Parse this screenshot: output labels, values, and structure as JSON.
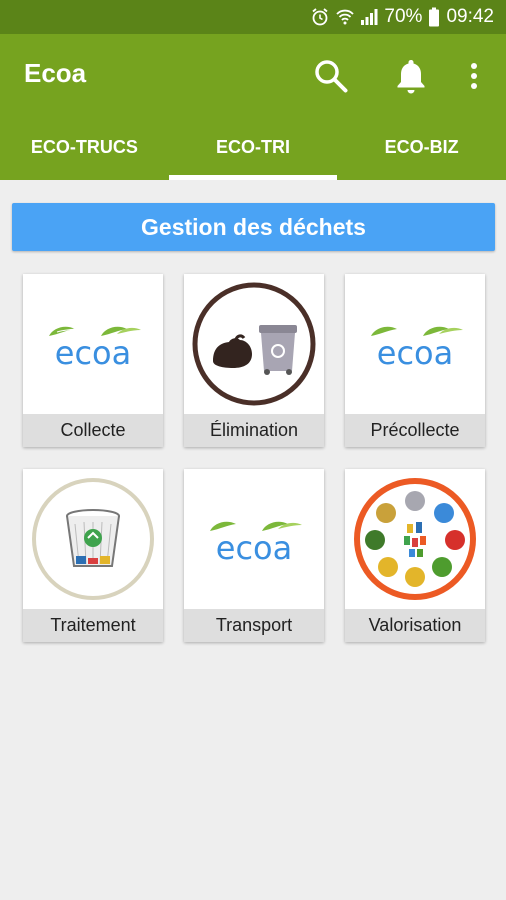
{
  "status_bar": {
    "battery": "70%",
    "time": "09:42"
  },
  "app_bar": {
    "title": "Ecoa"
  },
  "tabs": [
    {
      "label": "ECO-TRUCS",
      "active": false
    },
    {
      "label": "ECO-TRI",
      "active": true
    },
    {
      "label": "ECO-BIZ",
      "active": false
    }
  ],
  "section": {
    "title": "Gestion des déchets"
  },
  "cards": [
    {
      "label": "Collecte",
      "image": "ecoa-logo"
    },
    {
      "label": "Élimination",
      "image": "trash-bag-and-bin"
    },
    {
      "label": "Précollecte",
      "image": "ecoa-logo"
    },
    {
      "label": "Traitement",
      "image": "recycle-wastebasket"
    },
    {
      "label": "Transport",
      "image": "ecoa-logo"
    },
    {
      "label": "Valorisation",
      "image": "recycling-cycle-circle"
    }
  ],
  "logo_text": "ecoa",
  "colors": {
    "app_bar": "#76a31f",
    "status_bar": "#5b8418",
    "section_header": "#4aa3f5",
    "card_label_bg": "#dedede"
  }
}
